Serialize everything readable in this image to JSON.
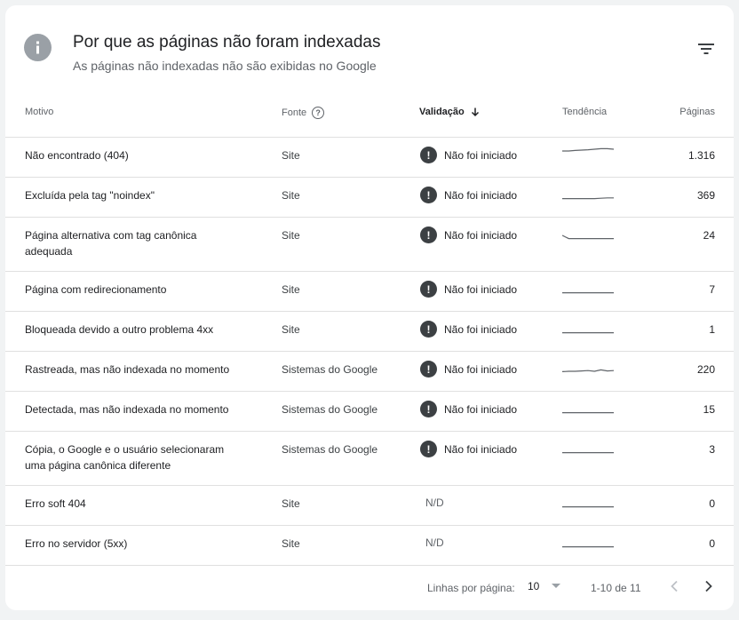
{
  "header": {
    "title": "Por que as páginas não foram indexadas",
    "subtitle": "As páginas não indexadas não são exibidas no Google"
  },
  "columns": {
    "motivo": "Motivo",
    "fonte": "Fonte",
    "validacao": "Validação",
    "tendencia": "Tendência",
    "paginas": "Páginas"
  },
  "rows": [
    {
      "motivo": "Não encontrado (404)",
      "fonte": "Site",
      "validacao": "Não foi iniciado",
      "status": "warning",
      "paginas": "1.316",
      "trend": [
        0.35,
        0.35,
        0.32,
        0.3,
        0.28,
        0.25,
        0.22,
        0.22,
        0.25
      ]
    },
    {
      "motivo": "Excluída pela tag \"noindex\"",
      "fonte": "Site",
      "validacao": "Não foi iniciado",
      "status": "warning",
      "paginas": "369",
      "trend": [
        0.78,
        0.78,
        0.78,
        0.78,
        0.78,
        0.78,
        0.76,
        0.74,
        0.74
      ]
    },
    {
      "motivo": "Página alternativa com tag canônica adequada",
      "fonte": "Site",
      "validacao": "Não foi iniciado",
      "status": "warning",
      "paginas": "24",
      "trend": [
        0.6,
        0.78,
        0.78,
        0.78,
        0.78,
        0.78,
        0.78,
        0.78,
        0.78
      ]
    },
    {
      "motivo": "Página com redirecionamento",
      "fonte": "Site",
      "validacao": "Não foi iniciado",
      "status": "warning",
      "paginas": "7",
      "trend": [
        0.78,
        0.78,
        0.78,
        0.78,
        0.78,
        0.78,
        0.78,
        0.78,
        0.78
      ]
    },
    {
      "motivo": "Bloqueada devido a outro problema 4xx",
      "fonte": "Site",
      "validacao": "Não foi iniciado",
      "status": "warning",
      "paginas": "1",
      "trend": [
        0.78,
        0.78,
        0.78,
        0.78,
        0.78,
        0.78,
        0.78,
        0.78,
        0.78
      ]
    },
    {
      "motivo": "Rastreada, mas não indexada no momento",
      "fonte": "Sistemas do Google",
      "validacao": "Não foi iniciado",
      "status": "warning",
      "paginas": "220",
      "trend": [
        0.72,
        0.7,
        0.7,
        0.68,
        0.66,
        0.7,
        0.62,
        0.68,
        0.66
      ]
    },
    {
      "motivo": "Detectada, mas não indexada no momento",
      "fonte": "Sistemas do Google",
      "validacao": "Não foi iniciado",
      "status": "warning",
      "paginas": "15",
      "trend": [
        0.78,
        0.78,
        0.78,
        0.78,
        0.78,
        0.78,
        0.78,
        0.78,
        0.78
      ]
    },
    {
      "motivo": "Cópia, o Google e o usuário selecionaram uma página canônica diferente",
      "fonte": "Sistemas do Google",
      "validacao": "Não foi iniciado",
      "status": "warning",
      "paginas": "3",
      "trend": [
        0.78,
        0.78,
        0.78,
        0.78,
        0.78,
        0.78,
        0.78,
        0.78,
        0.78
      ]
    },
    {
      "motivo": "Erro soft 404",
      "fonte": "Site",
      "validacao": "N/D",
      "status": "none",
      "paginas": "0",
      "trend": [
        0.78,
        0.78,
        0.78,
        0.78,
        0.78,
        0.78,
        0.78,
        0.78,
        0.78
      ]
    },
    {
      "motivo": "Erro no servidor (5xx)",
      "fonte": "Site",
      "validacao": "N/D",
      "status": "none",
      "paginas": "0",
      "trend": [
        0.78,
        0.78,
        0.78,
        0.78,
        0.78,
        0.78,
        0.78,
        0.78,
        0.78
      ]
    }
  ],
  "pagination": {
    "rows_label": "Linhas por página:",
    "rows_value": "10",
    "range": "1-10 de 11"
  },
  "icons": {
    "info": "info-icon",
    "filter": "filter-icon",
    "help": "help-icon",
    "sort": "arrow-down-icon",
    "warning": "exclamation-circle-icon",
    "dropdown": "caret-down-icon",
    "prev": "chevron-left-icon",
    "next": "chevron-right-icon"
  },
  "colors": {
    "warning": "#3c4043",
    "info": "#9aa0a6",
    "sparkline": "#5f6368"
  }
}
